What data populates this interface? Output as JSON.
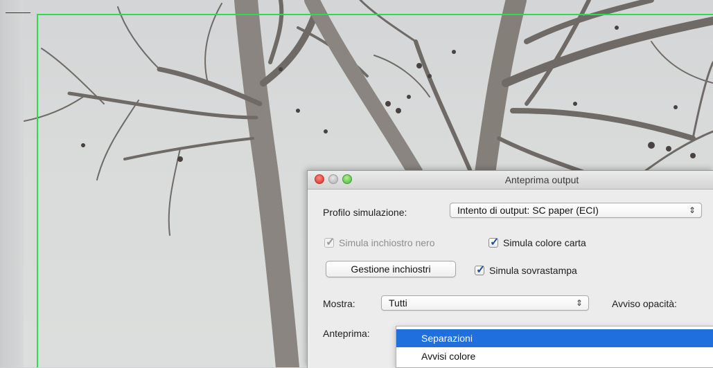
{
  "dialog": {
    "title": "Anteprima output",
    "profile": {
      "label": "Profilo simulazione:",
      "value": "Intento di output: SC paper (ECI)"
    },
    "simulate_black_ink": {
      "label": "Simula inchiostro nero",
      "checked": true,
      "enabled": false
    },
    "simulate_paper_color": {
      "label": "Simula colore carta",
      "checked": true
    },
    "ink_manager_button": "Gestione inchiostri",
    "simulate_overprint": {
      "label": "Simula sovrastampa",
      "checked": true
    },
    "show": {
      "label": "Mostra:",
      "value": "Tutti"
    },
    "opacity_warning_label": "Avviso opacità:",
    "preview": {
      "label": "Anteprima:",
      "options": [
        "Separazioni",
        "Avvisi colore"
      ],
      "selected": "Separazioni"
    }
  },
  "icons": {
    "select_arrows": "⇕",
    "checkmark": "✓"
  },
  "colors": {
    "guide": "#21e24d",
    "menu_highlight": "#1f6fde",
    "close_light": "#e0443e",
    "zoom_light": "#62c554"
  }
}
